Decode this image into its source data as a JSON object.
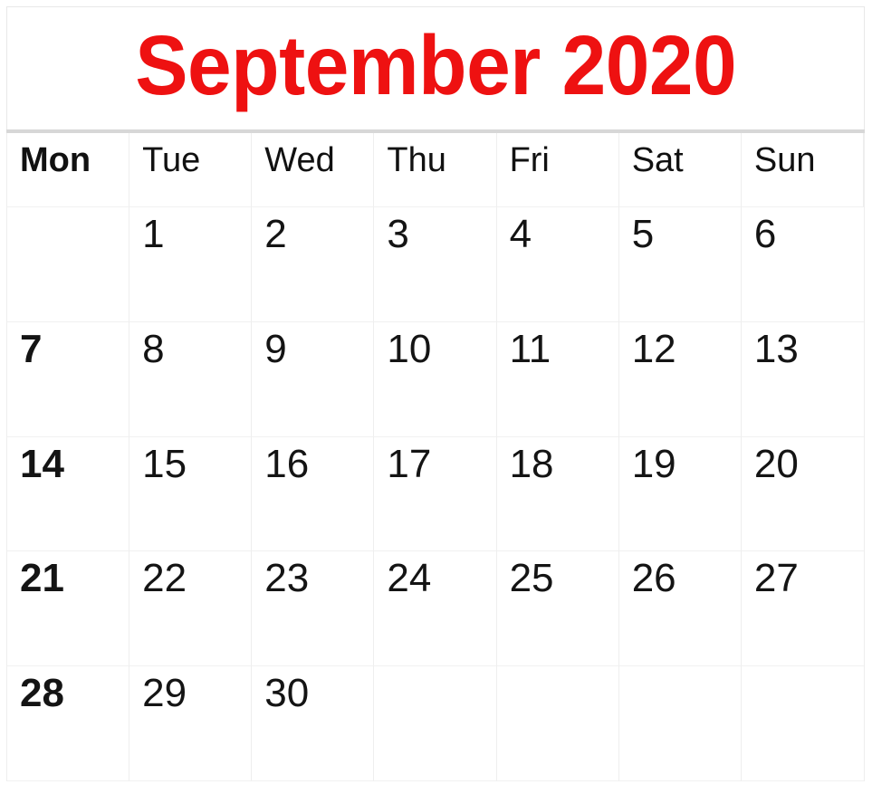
{
  "title": {
    "month_year": "September 2020",
    "month": "September",
    "year": "2020",
    "color": "#ee1111"
  },
  "calendar": {
    "week_start": "Mon",
    "weekday_headers": [
      {
        "label": "Mon",
        "bold": true
      },
      {
        "label": "Tue",
        "bold": false
      },
      {
        "label": "Wed",
        "bold": false
      },
      {
        "label": "Thu",
        "bold": false
      },
      {
        "label": "Fri",
        "bold": false
      },
      {
        "label": "Sat",
        "bold": false
      },
      {
        "label": "Sun",
        "bold": false
      }
    ],
    "weeks": [
      [
        {
          "day": ""
        },
        {
          "day": "1"
        },
        {
          "day": "2"
        },
        {
          "day": "3"
        },
        {
          "day": "4"
        },
        {
          "day": "5"
        },
        {
          "day": "6"
        }
      ],
      [
        {
          "day": "7"
        },
        {
          "day": "8"
        },
        {
          "day": "9"
        },
        {
          "day": "10"
        },
        {
          "day": "11"
        },
        {
          "day": "12"
        },
        {
          "day": "13"
        }
      ],
      [
        {
          "day": "14"
        },
        {
          "day": "15"
        },
        {
          "day": "16"
        },
        {
          "day": "17"
        },
        {
          "day": "18"
        },
        {
          "day": "19"
        },
        {
          "day": "20"
        }
      ],
      [
        {
          "day": "21"
        },
        {
          "day": "22"
        },
        {
          "day": "23"
        },
        {
          "day": "24"
        },
        {
          "day": "25"
        },
        {
          "day": "26"
        },
        {
          "day": "27"
        }
      ],
      [
        {
          "day": "28"
        },
        {
          "day": "29"
        },
        {
          "day": "30"
        },
        {
          "day": ""
        },
        {
          "day": ""
        },
        {
          "day": ""
        },
        {
          "day": ""
        }
      ]
    ]
  },
  "style": {
    "grid_line_color": "#eeeeee",
    "title_rule_color": "#d7d7d7",
    "day_text_color": "#141414",
    "background": "#ffffff"
  }
}
